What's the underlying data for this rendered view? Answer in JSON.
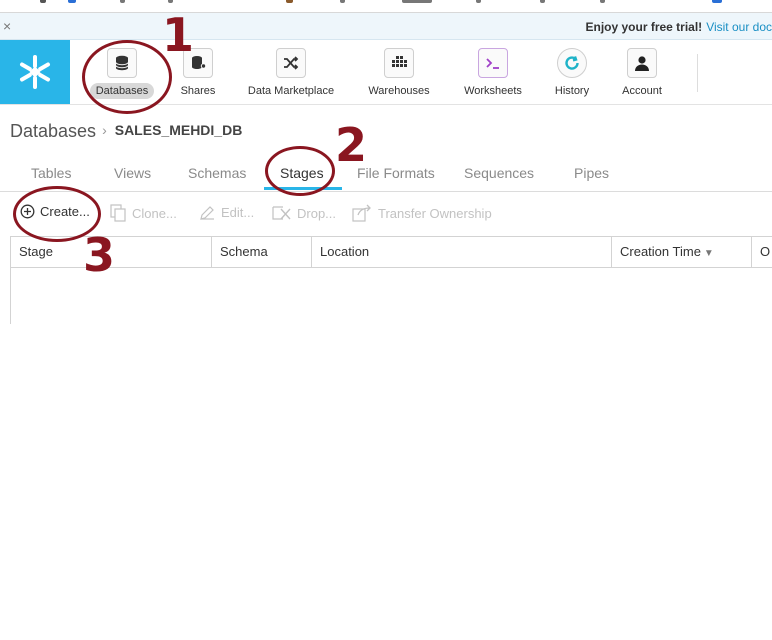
{
  "trial_banner": {
    "close_glyph": "×",
    "message": "Enjoy your free trial!",
    "link": "Visit our doc"
  },
  "nav": {
    "items": [
      {
        "label": "Databases",
        "icon": "database-icon",
        "active": true
      },
      {
        "label": "Shares",
        "icon": "shares-icon"
      },
      {
        "label": "Data Marketplace",
        "icon": "marketplace-shuffle-icon"
      },
      {
        "label": "Warehouses",
        "icon": "warehouse-grid-icon"
      },
      {
        "label": "Worksheets",
        "icon": "terminal-icon"
      },
      {
        "label": "History",
        "icon": "history-refresh-icon"
      },
      {
        "label": "Account",
        "icon": "user-icon"
      }
    ]
  },
  "breadcrumb": {
    "root": "Databases",
    "separator": "›",
    "database": "SALES_MEHDI_DB"
  },
  "tabs": [
    "Tables",
    "Views",
    "Schemas",
    "Stages",
    "File Formats",
    "Sequences",
    "Pipes"
  ],
  "active_tab": "Stages",
  "toolbar": {
    "create": "Create...",
    "clone": "Clone...",
    "edit": "Edit...",
    "drop": "Drop...",
    "transfer": "Transfer Ownership"
  },
  "table": {
    "columns": [
      "Stage",
      "Schema",
      "Location",
      "Creation Time",
      "O"
    ],
    "sort_indicator": "▼",
    "rows": []
  },
  "annotations": [
    "1",
    "2",
    "3"
  ],
  "colors": {
    "brand": "#29b5e8",
    "annotation": "#8a1620",
    "tab_active_underline": "#29b5e8"
  }
}
